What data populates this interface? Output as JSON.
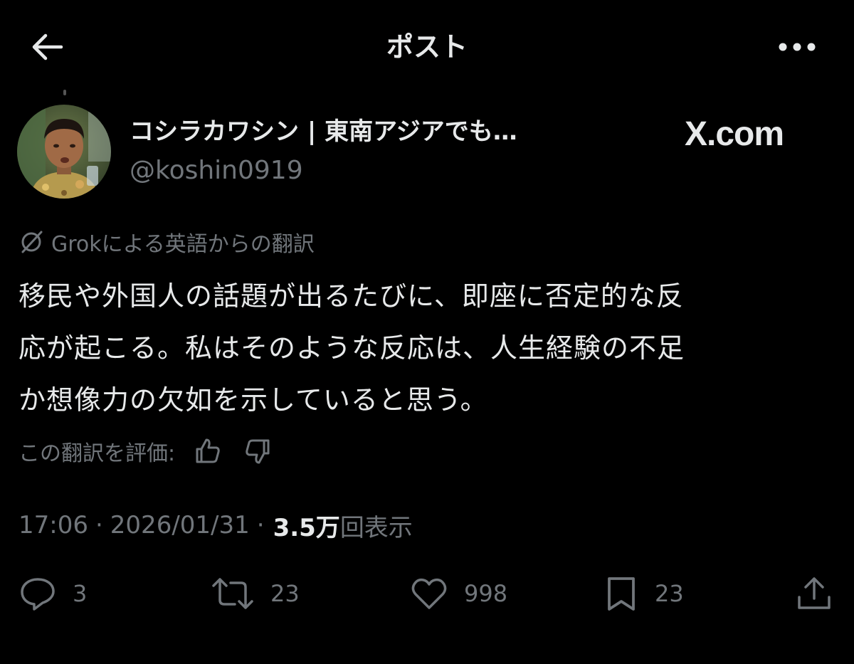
{
  "header": {
    "title": "ポスト",
    "back_icon": "arrow-left-icon",
    "more_icon": "ellipsis-icon"
  },
  "author": {
    "display_name": "コシラカワシン | 東南アジアでも…",
    "handle": "@koshin0919"
  },
  "watermark": "X.com",
  "translation": {
    "note": "Grokによる英語からの翻訳",
    "icon": "grok-icon"
  },
  "post": {
    "text_lines": [
      "移民や外国人の話題が出るたびに、即座に否定的な反",
      "応が起こる。私はそのような反応は、人生経験の不足",
      "か想像力の欠如を示していると思う。"
    ]
  },
  "rate": {
    "label": "この翻訳を評価:",
    "thumbs_up_icon": "thumbs-up-icon",
    "thumbs_down_icon": "thumbs-down-icon"
  },
  "meta": {
    "time": "17:06",
    "separator": "·",
    "date": "2026/01/31",
    "views_count": "3.5万",
    "views_label": "回表示"
  },
  "actions": {
    "replies": "3",
    "reposts": "23",
    "likes": "998",
    "bookmarks": "23"
  },
  "colors": {
    "background": "#000000",
    "text_primary": "#e7e9ea",
    "text_secondary": "#71767b"
  }
}
